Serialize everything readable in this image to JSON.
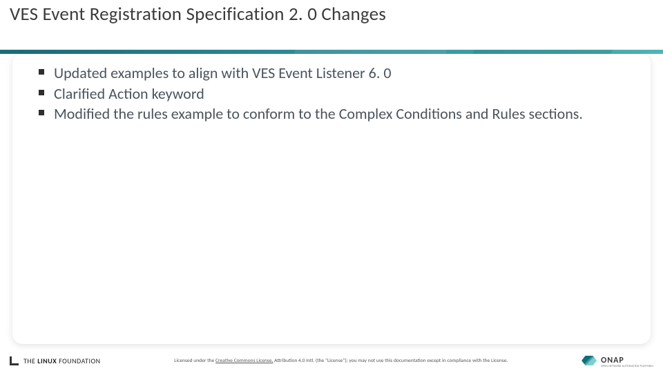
{
  "title": "VES Event Registration Specification 2. 0 Changes",
  "bullets": [
    "Updated examples to align with VES Event Listener 6. 0",
    "Clarified Action keyword",
    "Modified the rules example to conform to the Complex Conditions and Rules sections."
  ],
  "footer": {
    "linux_foundation_prefix": "THE",
    "linux_foundation_bold": "LINUX",
    "linux_foundation_suffix": "FOUNDATION",
    "license_prefix": "Licensed under the ",
    "license_link": "Creative Commons License,",
    "license_suffix": " Attribution 4.0 Intl. (the \"License\"); you may not use this documentation except in compliance with the License.",
    "onap_name": "ONAP",
    "onap_tagline": "OPEN NETWORK AUTOMATION PLATFORM"
  }
}
